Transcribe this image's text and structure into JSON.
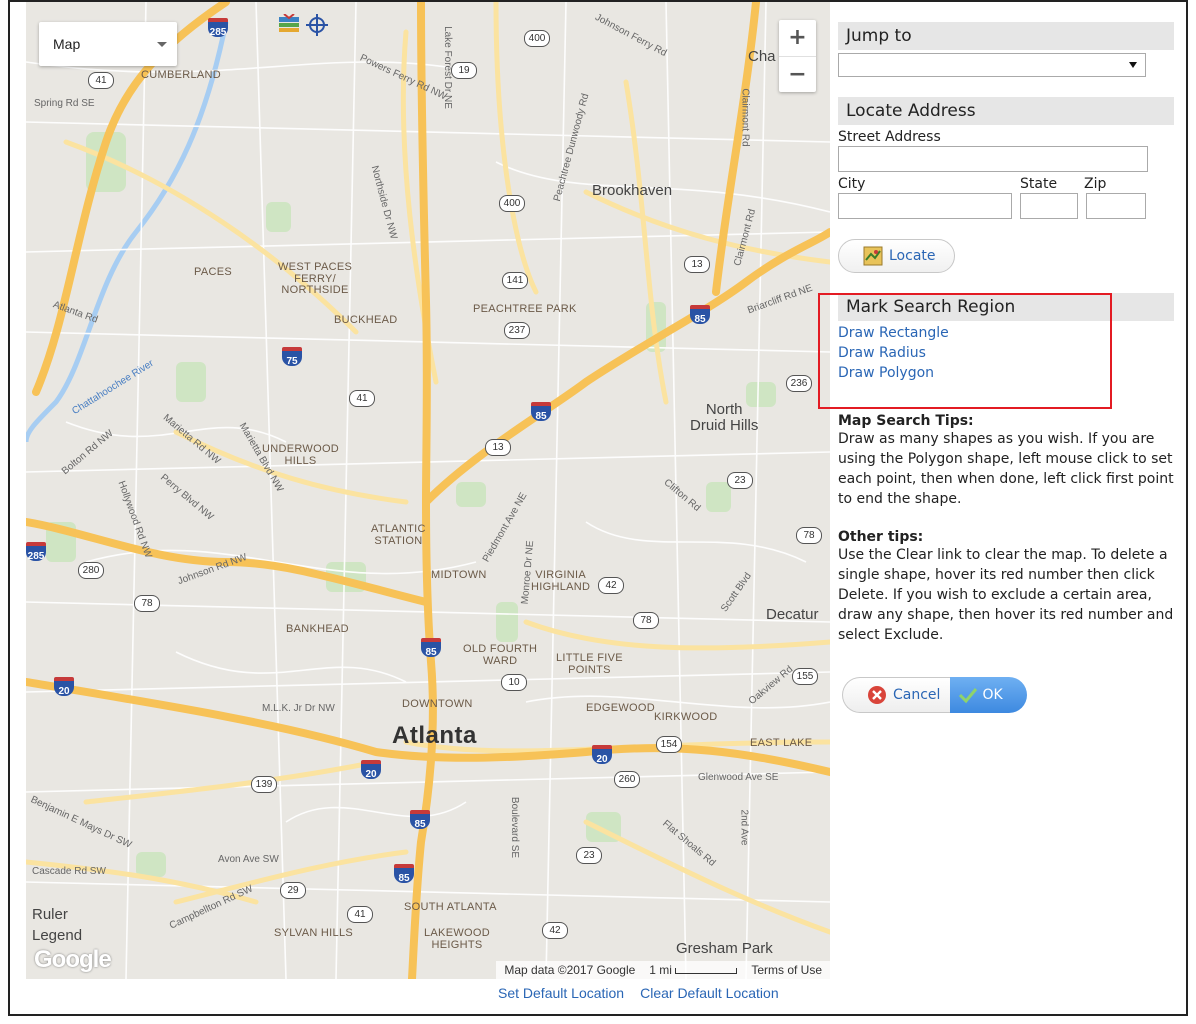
{
  "map": {
    "type_selector": "Map",
    "zoom_in": "+",
    "zoom_out": "−",
    "logo": "Google",
    "attribution": "Map data ©2017 Google",
    "scale": "1 mi",
    "terms": "Terms of Use",
    "places": {
      "atlanta": "Atlanta",
      "brookhaven": "Brookhaven",
      "north_druid_hills": "North\nDruid Hills",
      "decatur": "Decatur",
      "gresham_park": "Gresham Park",
      "cumberland": "CUMBERLAND",
      "paces": "PACES",
      "west_paces": "WEST PACES\nFERRY/\nNORTHSIDE",
      "buckhead": "BUCKHEAD",
      "peachtree_park": "PEACHTREE PARK",
      "underwood_hills": "UNDERWOOD\nHILLS",
      "atlantic_station": "ATLANTIC\nSTATION",
      "midtown": "MIDTOWN",
      "virginia_highland": "VIRGINIA\nHIGHLAND",
      "bankhead": "BANKHEAD",
      "old_fourth_ward": "OLD FOURTH\nWARD",
      "little_five_points": "LITTLE FIVE\nPOINTS",
      "downtown": "DOWNTOWN",
      "edgewood": "EDGEWOOD",
      "kirkwood": "KIRKWOOD",
      "east_lake": "EAST LAKE",
      "south_atlanta": "SOUTH ATLANTA",
      "sylvan_hills": "SYLVAN HILLS",
      "lakewood_heights": "LAKEWOOD\nHEIGHTS",
      "ruler": "Ruler",
      "legend": "Legend",
      "cha": "Cha"
    },
    "roads": {
      "spring_rd": "Spring Rd SE",
      "powers_ferry": "Powers Ferry Rd NW",
      "lake_forest": "Lake Forest Dr NE",
      "johnson_ferry": "Johnson Ferry Rd",
      "northside": "Northside Dr NW",
      "peachtree_dunwoody": "Peachtree Dunwoody Rd",
      "clairmont": "Clairmont Rd",
      "atlanta_rd": "Atlanta Rd",
      "chattahoochee": "Chattahoochee River",
      "bolton": "Bolton Rd NW",
      "marietta": "Marietta Rd NW",
      "marietta_blvd": "Marietta Blvd NW",
      "perry": "Perry Blvd NW",
      "hollywood": "Hollywood Rd NW",
      "johnson_rd": "Johnson Rd NW",
      "piedmont": "Piedmont Ave NE",
      "monroe": "Monroe Dr NE",
      "clifton": "Clifton Rd",
      "scott": "Scott Blvd",
      "mlk": "M.L.K. Jr Dr NW",
      "glenwood": "Glenwood Ave SE",
      "boulevard": "Boulevard SE",
      "flat_shoals": "Flat Shoals Rd",
      "avon": "Avon Ave SW",
      "cascade": "Cascade Rd SW",
      "campbellton": "Campbellton Rd SW",
      "ben_mays": "Benjamin E Mays Dr SW",
      "briarcliff": "Briarcliff Rd NE",
      "oakview": "Oakview Rd",
      "clairmont_rd": "Clairmont Rd",
      "second_ave": "2nd Ave"
    },
    "links": {
      "set_default": "Set Default Location",
      "clear_default": "Clear Default Location"
    }
  },
  "panel": {
    "jump_to": {
      "title": "Jump to",
      "value": ""
    },
    "locate": {
      "title": "Locate Address",
      "street_label": "Street Address",
      "city_label": "City",
      "state_label": "State",
      "zip_label": "Zip",
      "button": "Locate"
    },
    "search_region": {
      "title": "Mark Search Region",
      "rectangle": "Draw Rectangle",
      "radius": "Draw Radius",
      "polygon": "Draw Polygon"
    },
    "tips": {
      "title": "Map Search Tips:",
      "text": "Draw as many shapes as you wish. If you are using the Polygon shape, left mouse click to set each point, then when done, left click first point to end the shape.",
      "other_title": "Other tips:",
      "other_text": "Use the Clear link to clear the map. To delete a single shape, hover its red number then click Delete. If you wish to exclude a certain area, draw any shape, then hover its red number and select Exclude."
    },
    "buttons": {
      "cancel": "Cancel",
      "ok": "OK"
    }
  },
  "colors": {
    "link": "#2a66b5",
    "highlight_box": "#e31b23",
    "ok_button": "#3d89e0"
  }
}
